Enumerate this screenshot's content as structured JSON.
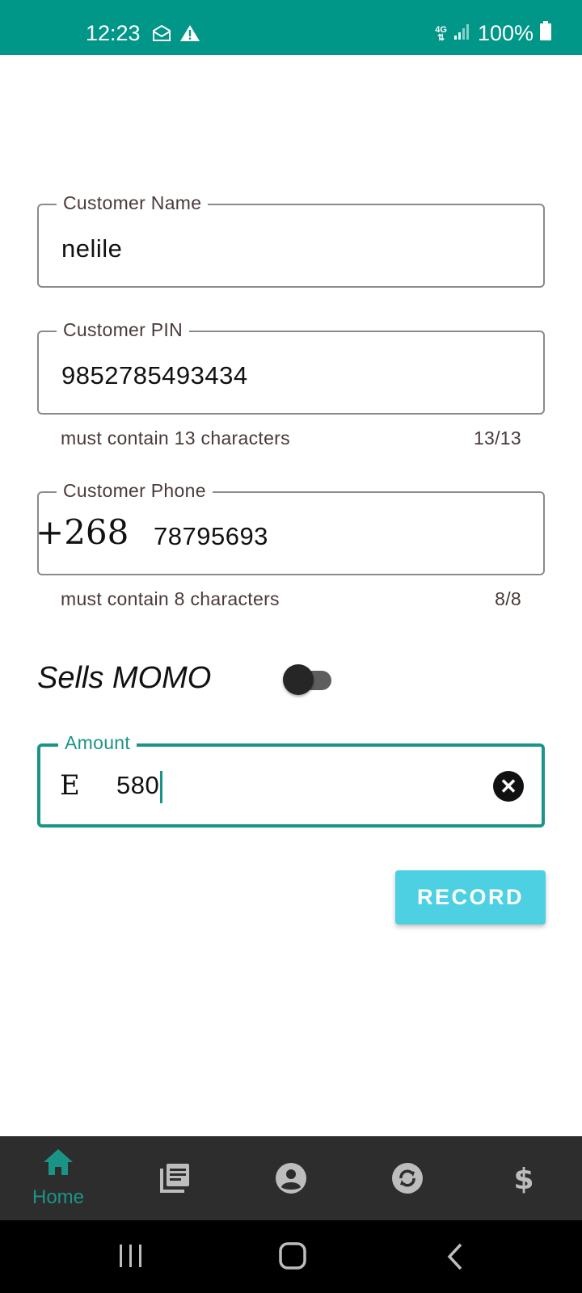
{
  "status_bar": {
    "time": "12:23",
    "network": "4G",
    "battery": "100%"
  },
  "form": {
    "customer_name": {
      "label": "Customer Name",
      "value": "nelile"
    },
    "customer_pin": {
      "label": "Customer PIN",
      "value": "9852785493434",
      "helper": "must contain 13 characters",
      "counter": "13/13"
    },
    "customer_phone": {
      "label": "Customer Phone",
      "prefix": "+268",
      "value": "78795693",
      "helper": "must contain 8 characters",
      "counter": "8/8"
    },
    "sells_momo": {
      "label": "Sells MOMO",
      "enabled": false
    },
    "amount": {
      "label": "Amount",
      "currency": "E",
      "value": "580"
    },
    "record_button": "RECORD"
  },
  "bottom_nav": {
    "active": "home",
    "items": [
      {
        "id": "home",
        "label": "Home",
        "icon": "home-icon"
      },
      {
        "id": "records",
        "label": "",
        "icon": "library-books-icon"
      },
      {
        "id": "profile",
        "label": "",
        "icon": "account-circle-icon"
      },
      {
        "id": "sync",
        "label": "",
        "icon": "sync-icon"
      },
      {
        "id": "money",
        "label": "",
        "icon": "dollar-icon"
      }
    ]
  },
  "colors": {
    "primary": "#009688",
    "accent": "#1b9488",
    "button": "#4dd0e1",
    "nav_background": "#2d2d2d"
  }
}
